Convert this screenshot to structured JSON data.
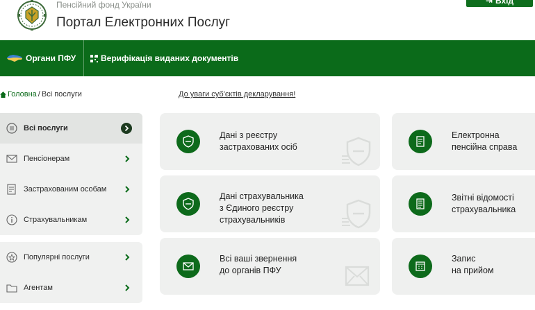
{
  "header": {
    "org_name": "Пенсійний фонд України",
    "portal_title": "Портал Електронних Послуг",
    "login_label": "Вхід"
  },
  "nav": {
    "pfu_label": "Органи ПФУ",
    "verification_label": "Верифікація виданих документів"
  },
  "breadcrumb": {
    "home": "Головна",
    "separator": "/",
    "current": "Всі послуги"
  },
  "notice_link": "До уваги суб'єктів декларування!",
  "sidebar": {
    "group1": [
      {
        "label": "Всі послуги",
        "icon": "list-icon",
        "active": true
      },
      {
        "label": "Пенсіонерам",
        "icon": "envelope-icon"
      },
      {
        "label": "Застрахованим особам",
        "icon": "document-icon"
      },
      {
        "label": "Страхувальникам",
        "icon": "info-icon"
      }
    ],
    "group2": [
      {
        "label": "Популярні послуги",
        "icon": "star-icon"
      },
      {
        "label": "Агентам",
        "icon": "folder-icon"
      }
    ]
  },
  "cards": [
    {
      "lines": [
        "Дані з реєстру",
        "застрахованих осіб"
      ],
      "icon": "shield-icon"
    },
    {
      "lines": [
        "Електронна",
        "пенсійна справа"
      ],
      "icon": "file-icon"
    },
    {
      "lines": [
        "Дані страхувальника",
        "з Єдиного реєстру",
        "страхувальників"
      ],
      "icon": "shield-icon"
    },
    {
      "lines": [
        "Звітні відомості",
        "страхувальника"
      ],
      "icon": "report-icon"
    },
    {
      "lines": [
        "Всі ваші звернення",
        "до органів ПФУ"
      ],
      "icon": "envelope-icon"
    },
    {
      "lines": [
        "Запис",
        "на прийом"
      ],
      "icon": "calendar-icon"
    }
  ],
  "colors": {
    "brand_green": "#0b6b1a",
    "card_bg": "#eff0ef"
  }
}
